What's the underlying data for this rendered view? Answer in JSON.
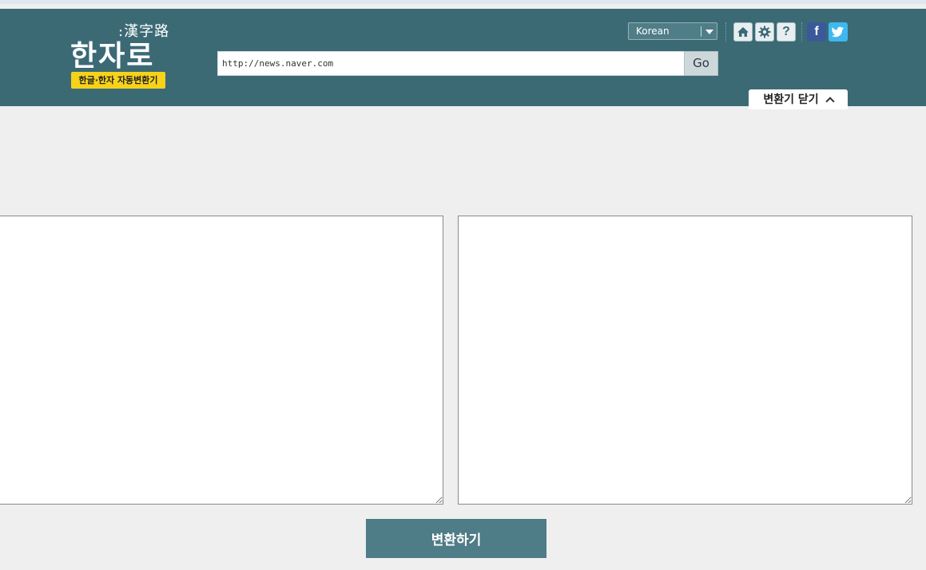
{
  "logo": {
    "hanja": ":漢字路",
    "main": "한자로",
    "tagline": "한글·한자 자동변환기"
  },
  "language": {
    "selected": "Korean"
  },
  "icons": {
    "home": "home-icon",
    "settings": "gear-icon",
    "help": "help-icon",
    "facebook": "facebook-icon",
    "twitter": "twitter-icon"
  },
  "help_glyph": "?",
  "facebook_glyph": "f",
  "url_bar": {
    "value": "http://news.naver.com",
    "go_label": "Go"
  },
  "close_tab": {
    "label": "변환기 닫기"
  },
  "editor": {
    "convert_label": "변환하기"
  },
  "colors": {
    "header": "#3b6a75",
    "tagline_bg": "#f7d21a",
    "convert_button": "#4e7c87",
    "facebook": "#3b5998",
    "twitter": "#3fb8ee"
  }
}
